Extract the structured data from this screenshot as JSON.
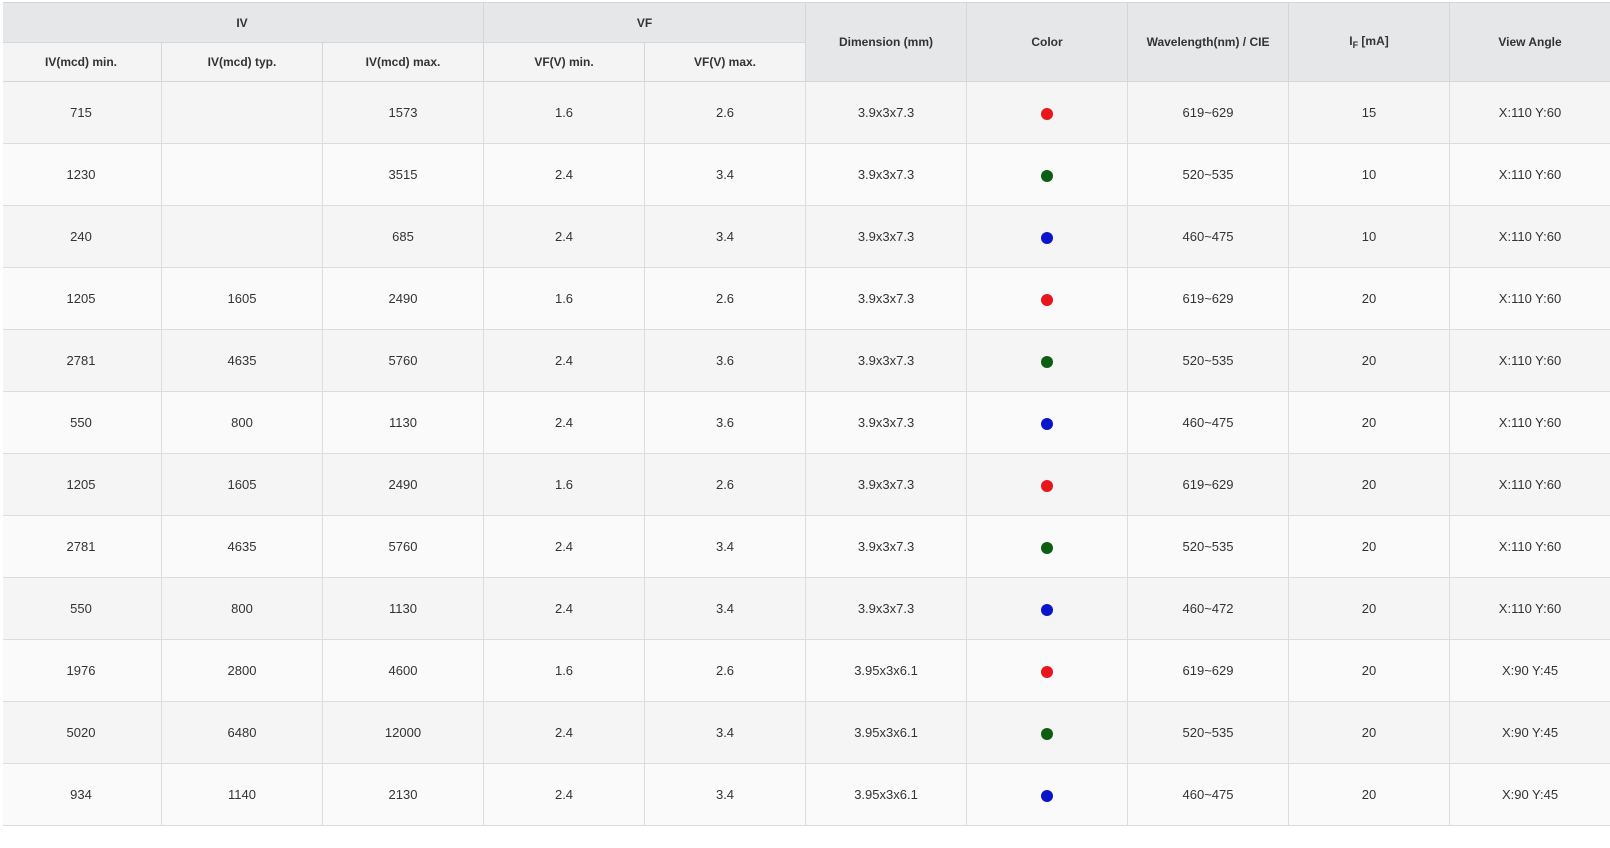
{
  "headers": {
    "iv_group": "IV",
    "vf_group": "VF",
    "iv_min": "IV(mcd) min.",
    "iv_typ": "IV(mcd) typ.",
    "iv_max": "IV(mcd) max.",
    "vf_min": "VF(V) min.",
    "vf_max": "VF(V) max.",
    "dimension": "Dimension (mm)",
    "color": "Color",
    "wavelength": "Wavelength(nm) / CIE",
    "if_prefix": "I",
    "if_sub": "F",
    "if_unit": " [mA]",
    "view_angle": "View Angle"
  },
  "colors": {
    "red": "#e8161c",
    "green": "#0d5e12",
    "blue": "#0a14c8"
  },
  "rows": [
    {
      "iv_min": "715",
      "iv_typ": "",
      "iv_max": "1573",
      "vf_min": "1.6",
      "vf_max": "2.6",
      "dim": "3.9x3x7.3",
      "color": "red",
      "wl": "619~629",
      "if": "15",
      "angle": "X:110 Y:60"
    },
    {
      "iv_min": "1230",
      "iv_typ": "",
      "iv_max": "3515",
      "vf_min": "2.4",
      "vf_max": "3.4",
      "dim": "3.9x3x7.3",
      "color": "green",
      "wl": "520~535",
      "if": "10",
      "angle": "X:110 Y:60"
    },
    {
      "iv_min": "240",
      "iv_typ": "",
      "iv_max": "685",
      "vf_min": "2.4",
      "vf_max": "3.4",
      "dim": "3.9x3x7.3",
      "color": "blue",
      "wl": "460~475",
      "if": "10",
      "angle": "X:110 Y:60"
    },
    {
      "iv_min": "1205",
      "iv_typ": "1605",
      "iv_max": "2490",
      "vf_min": "1.6",
      "vf_max": "2.6",
      "dim": "3.9x3x7.3",
      "color": "red",
      "wl": "619~629",
      "if": "20",
      "angle": "X:110 Y:60"
    },
    {
      "iv_min": "2781",
      "iv_typ": "4635",
      "iv_max": "5760",
      "vf_min": "2.4",
      "vf_max": "3.6",
      "dim": "3.9x3x7.3",
      "color": "green",
      "wl": "520~535",
      "if": "20",
      "angle": "X:110 Y:60"
    },
    {
      "iv_min": "550",
      "iv_typ": "800",
      "iv_max": "1130",
      "vf_min": "2.4",
      "vf_max": "3.6",
      "dim": "3.9x3x7.3",
      "color": "blue",
      "wl": "460~475",
      "if": "20",
      "angle": "X:110 Y:60"
    },
    {
      "iv_min": "1205",
      "iv_typ": "1605",
      "iv_max": "2490",
      "vf_min": "1.6",
      "vf_max": "2.6",
      "dim": "3.9x3x7.3",
      "color": "red",
      "wl": "619~629",
      "if": "20",
      "angle": "X:110 Y:60"
    },
    {
      "iv_min": "2781",
      "iv_typ": "4635",
      "iv_max": "5760",
      "vf_min": "2.4",
      "vf_max": "3.4",
      "dim": "3.9x3x7.3",
      "color": "green",
      "wl": "520~535",
      "if": "20",
      "angle": "X:110 Y:60"
    },
    {
      "iv_min": "550",
      "iv_typ": "800",
      "iv_max": "1130",
      "vf_min": "2.4",
      "vf_max": "3.4",
      "dim": "3.9x3x7.3",
      "color": "blue",
      "wl": "460~472",
      "if": "20",
      "angle": "X:110 Y:60"
    },
    {
      "iv_min": "1976",
      "iv_typ": "2800",
      "iv_max": "4600",
      "vf_min": "1.6",
      "vf_max": "2.6",
      "dim": "3.95x3x6.1",
      "color": "red",
      "wl": "619~629",
      "if": "20",
      "angle": "X:90 Y:45"
    },
    {
      "iv_min": "5020",
      "iv_typ": "6480",
      "iv_max": "12000",
      "vf_min": "2.4",
      "vf_max": "3.4",
      "dim": "3.95x3x6.1",
      "color": "green",
      "wl": "520~535",
      "if": "20",
      "angle": "X:90 Y:45"
    },
    {
      "iv_min": "934",
      "iv_typ": "1140",
      "iv_max": "2130",
      "vf_min": "2.4",
      "vf_max": "3.4",
      "dim": "3.95x3x6.1",
      "color": "blue",
      "wl": "460~475",
      "if": "20",
      "angle": "X:90 Y:45"
    }
  ]
}
